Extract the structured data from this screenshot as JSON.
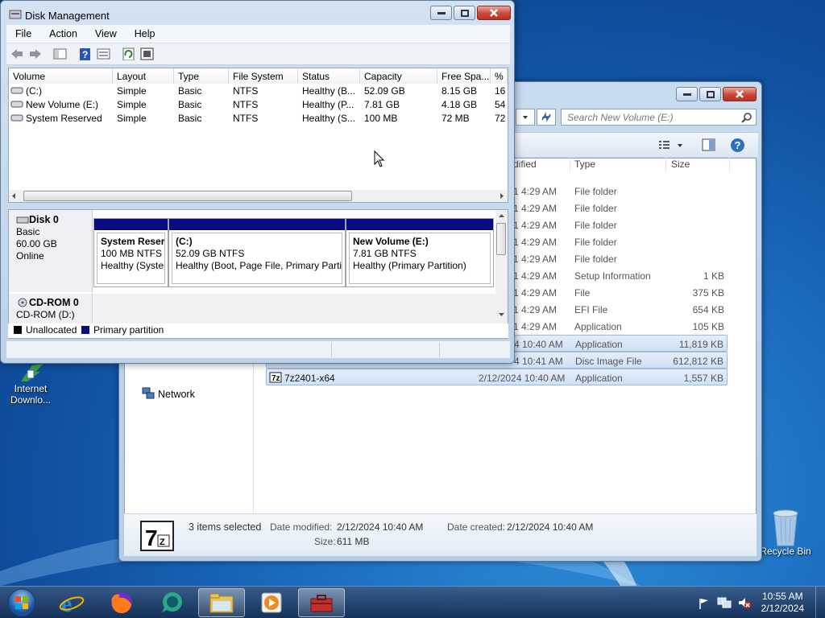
{
  "desktop": {
    "icons": [
      {
        "label": "Internet Downlo..."
      },
      {
        "label": "Recycle Bin"
      }
    ]
  },
  "explorer": {
    "search_placeholder": "Search New Volume (E:)",
    "columns": [
      "dified",
      "Type",
      "Size"
    ],
    "rows": [
      {
        "date": "1 4:29 AM",
        "type": "File folder",
        "size": ""
      },
      {
        "date": "1 4:29 AM",
        "type": "File folder",
        "size": ""
      },
      {
        "date": "1 4:29 AM",
        "type": "File folder",
        "size": ""
      },
      {
        "date": "1 4:29 AM",
        "type": "File folder",
        "size": ""
      },
      {
        "date": "1 4:29 AM",
        "type": "File folder",
        "size": ""
      },
      {
        "date": "1 4:29 AM",
        "type": "Setup Information",
        "size": "1 KB"
      },
      {
        "date": "1 4:29 AM",
        "type": "File",
        "size": "375 KB"
      },
      {
        "date": "1 4:29 AM",
        "type": "EFI File",
        "size": "654 KB"
      },
      {
        "date": "1 4:29 AM",
        "type": "Application",
        "size": "105 KB"
      },
      {
        "date": "4 10:40 AM",
        "type": "Application",
        "size": "11,819 KB"
      },
      {
        "date": "4 10:41 AM",
        "type": "Disc Image File",
        "size": "612,812 KB"
      },
      {
        "name": "7z2401-x64",
        "date": "2/12/2024 10:40 AM",
        "type": "Application",
        "size": "1,557 KB"
      }
    ],
    "nav_network": "Network",
    "details": {
      "selected": "3 items selected",
      "date_modified_label": "Date modified:",
      "date_modified": "2/12/2024 10:40 AM",
      "date_created_label": "Date created:",
      "date_created": "2/12/2024 10:40 AM",
      "size_label": "Size:",
      "size": "611 MB"
    }
  },
  "diskmgmt": {
    "title": "Disk Management",
    "menu": [
      "File",
      "Action",
      "View",
      "Help"
    ],
    "columns": [
      "Volume",
      "Layout",
      "Type",
      "File System",
      "Status",
      "Capacity",
      "Free Spa...",
      "% F"
    ],
    "volumes": [
      {
        "volume": "(C:)",
        "layout": "Simple",
        "type": "Basic",
        "fs": "NTFS",
        "status": "Healthy (B...",
        "capacity": "52.09 GB",
        "free": "8.15 GB",
        "pct": "16"
      },
      {
        "volume": "New Volume (E:)",
        "layout": "Simple",
        "type": "Basic",
        "fs": "NTFS",
        "status": "Healthy (P...",
        "capacity": "7.81 GB",
        "free": "4.18 GB",
        "pct": "54"
      },
      {
        "volume": "System Reserved",
        "layout": "Simple",
        "type": "Basic",
        "fs": "NTFS",
        "status": "Healthy (S...",
        "capacity": "100 MB",
        "free": "72 MB",
        "pct": "72"
      }
    ],
    "disk0": {
      "name": "Disk 0",
      "kind": "Basic",
      "size": "60.00 GB",
      "state": "Online"
    },
    "partitions": [
      {
        "title": "System Reser",
        "size": "100 MB NTFS",
        "status": "Healthy (Syster"
      },
      {
        "title": "(C:)",
        "size": "52.09 GB NTFS",
        "status": "Healthy (Boot, Page File, Primary Partit"
      },
      {
        "title": "New Volume  (E:)",
        "size": "7.81 GB NTFS",
        "status": "Healthy (Primary Partition)"
      }
    ],
    "cdrom": {
      "name": "CD-ROM 0",
      "drive": "CD-ROM (D:)"
    },
    "legend": {
      "unallocated": "Unallocated",
      "primary": "Primary partition"
    },
    "colors": {
      "primary": "#0b0b80",
      "unallocated": "#000000"
    }
  },
  "taskbar": {
    "time": "10:55 AM",
    "date": "2/12/2024"
  }
}
